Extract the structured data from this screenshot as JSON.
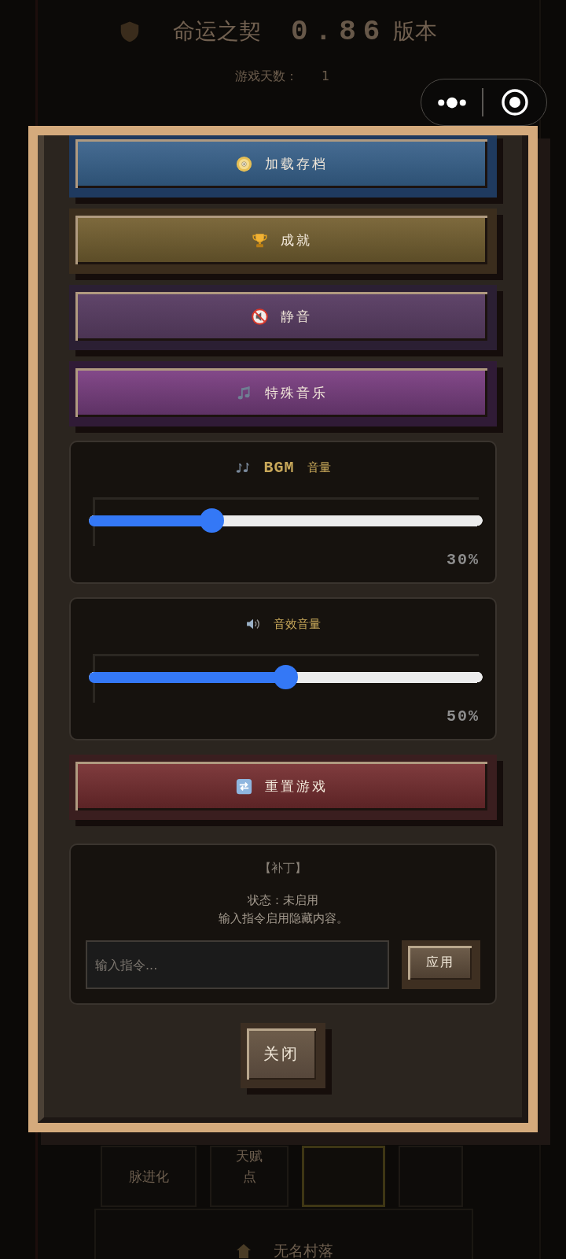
{
  "background": {
    "title": "命运之契",
    "version": "0.86",
    "version_suffix": "版本",
    "day_counter": {
      "label": "游戏天数：",
      "value": "1"
    },
    "tiles": [
      {
        "label": "脉进化",
        "selected": false
      },
      {
        "label": "天赋点",
        "selected": false
      },
      {
        "selected": true
      },
      {
        "selected": false
      }
    ],
    "location": "无名村落"
  },
  "settings": {
    "menu_buttons": [
      {
        "kind": "load",
        "label": "加载存档"
      },
      {
        "kind": "achievements",
        "label": "成就"
      },
      {
        "kind": "mute",
        "label": "静音"
      },
      {
        "kind": "music",
        "label": "特殊音乐"
      }
    ],
    "volume_sliders": [
      {
        "kind": "bgm",
        "tag": "BGM",
        "label": "音量",
        "level": 0.3,
        "reading": "30%"
      },
      {
        "kind": "effects",
        "label": "音效音量",
        "level": 0.5,
        "reading": "50%"
      }
    ],
    "reset_button": {
      "kind": "reset",
      "label": "重置游戏"
    },
    "patch": {
      "title": "【补丁】",
      "status": "状态：未启用",
      "hint": "输入指令启用隐藏内容。",
      "placeholder": "输入指令...",
      "apply_button": "应用"
    },
    "close_button": "关闭"
  }
}
